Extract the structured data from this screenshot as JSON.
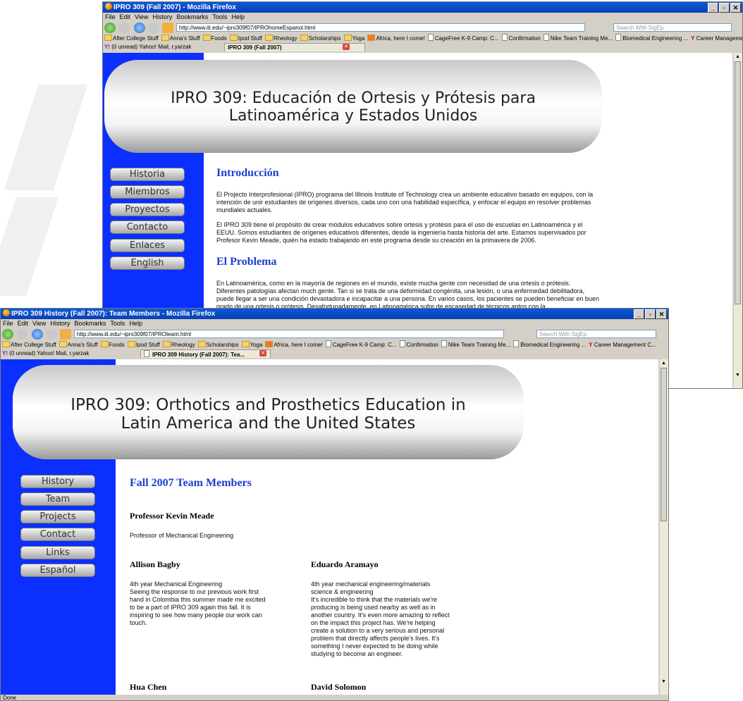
{
  "back_window": {
    "title": "IPRO 309 (Fall 2007) - Mozilla Firefox",
    "menu": [
      "File",
      "Edit",
      "View",
      "History",
      "Bookmarks",
      "Tools",
      "Help"
    ],
    "url": "http://www.iit.edu/~ipro309f07/IPROhomeEspanol.html",
    "search_placeholder": "Search With SigEp",
    "bookmarks": [
      "After College Stuff",
      "Anna's Stuff",
      "Foods",
      "Ipod Stuff",
      "Rheology",
      "Scholarships",
      "Yoga",
      "Africa, here I come!",
      "CageFree K-9 Camp: C...",
      "Confirmation",
      "Nike Team Training Me...",
      "Biomedical Engineering ...",
      "Career Management C..."
    ],
    "mail_tab": "(0 unread) Yahoo! Mail, r.yarzak",
    "active_tab": "IPRO 309 (Fall 2007)",
    "header_line1": "IPRO 309: Educación de Ortesis y Prótesis para",
    "header_line2": "Latinoamérica y Estados Unidos",
    "nav": [
      "Historia",
      "Miembros",
      "Proyectos",
      "Contacto",
      "Enlaces",
      "English"
    ],
    "intro_heading": "Introducción",
    "intro_p1": "El Projecto Interprofesional (IPRO) programa del Illinois Institute of Technology crea un ambiente educativo basado en equipos, con la intención de unir estudiantes de orígenes diversos, cada uno con una habilidad específica, y enfocar el equipo en resolver problemas mundiales actuales.",
    "intro_p2": "El IPRO 309 tiene el propósito de crear módulos educativos sobre ortesis y protésis para el uso de escuelas en Latinoamérica y el EEUU. Somos estudiantes de orígenes educativos diferentes, desde la ingeniería hasta historia del arte. Estamos supervisados por Profesor Kevin Meade, quién ha estado trabajando en este programa desde su creación en la primavera de 2006.",
    "problem_heading": "El Problema",
    "problem_p": "En Latinoamérica, como en la mayoría de regiones en el mundo, existe mucha gente con necesidad de una ortesis o prótesis. Diferentes patologías afectan much gente. Tan si se trata de una deformidad congénita, una lesión, o una enfermedad debilitadora, puede llegar a ser una condición devastadora e incapacitar a una persona. En varios casos, los pacientes se pueden beneficiar en buen grado de una ortesis o prótesis. Desafortunadamente, en Latinoamérica sufre de escasedad de técnicos aptos con la"
  },
  "front_window": {
    "title": "IPRO 309 History (Fall 2007): Team Members - Mozilla Firefox",
    "menu": [
      "File",
      "Edit",
      "View",
      "History",
      "Bookmarks",
      "Tools",
      "Help"
    ],
    "url": "http://www.iit.edu/~ipro309f07/IPROteam.html",
    "search_placeholder": "Search With SigEp",
    "bookmarks": [
      "After College Stuff",
      "Anna's Stuff",
      "Foods",
      "Ipod Stuff",
      "Rheology",
      "Scholarships",
      "Yoga",
      "Africa, here I come!",
      "CageFree K-9 Camp: C...",
      "Confirmation",
      "Nike Team Training Me...",
      "Biomedical Engineering ...",
      "Career Management C..."
    ],
    "mail_tab": "(0 unread) Yahoo! Mail, r.yarzak",
    "active_tab": "IPRO 309 History (Fall 2007): Tea...",
    "header_line1": "IPRO 309: Orthotics and Prosthetics Education in",
    "header_line2": "Latin America and the United States",
    "nav": [
      "History",
      "Team",
      "Projects",
      "Contact",
      "Links",
      "Español"
    ],
    "heading": "Fall 2007 Team Members",
    "prof_name": "Professor Kevin Meade",
    "prof_title": "Professor of Mechanical Engineering",
    "member1_name": "Allison Bagby",
    "member1_text": "4th year Mechanical Engineering\nSeeing the response to our previous work first hand in Colombia this summer made me excited to be a part of IPRO 309 again this fall. It is inspiring to see how many people our work can touch.",
    "member2_name": "Eduardo Aramayo",
    "member2_text": "4th year mechanical engineering/materials science & engineering\nIt's incredible to think that the materials we're producing is being used nearby as well as in another country. It's even more amazing to reflect on the impact this project has. We're helping create a solution to a very serious and personal problem that directly affects people's lives. It's something I never expected to be doing while studying to become an engineer.",
    "member3_name": "Hua Chen",
    "member4_name": "David Solomon",
    "status": "Done"
  },
  "colors": {
    "sidebar_blue": "#0a2fff",
    "heading_blue": "#1a3fcf",
    "titlebar": "#0a4fc8"
  }
}
